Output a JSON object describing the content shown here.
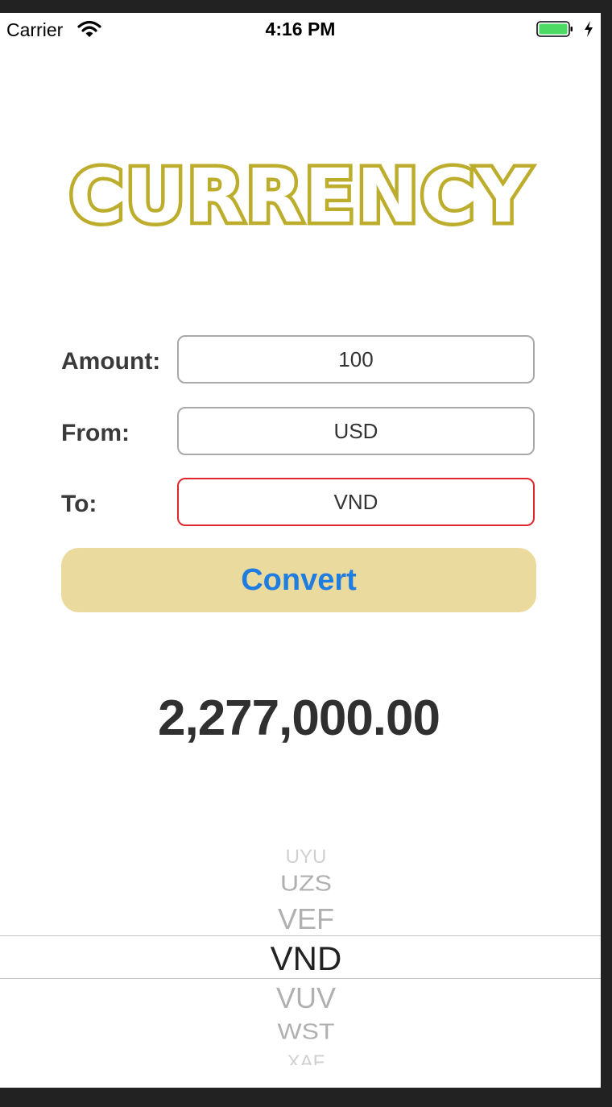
{
  "status_bar": {
    "carrier": "Carrier",
    "time": "4:16 PM",
    "battery_color": "#4cd964"
  },
  "app": {
    "title": "CURRENCY",
    "title_color": "#bcad2c"
  },
  "form": {
    "amount_label": "Amount:",
    "amount_value": "100",
    "from_label": "From:",
    "from_value": "USD",
    "to_label": "To:",
    "to_value": "VND",
    "active_field_border": "#e0262d"
  },
  "convert_button": {
    "label": "Convert",
    "background": "#ebda9e",
    "text_color": "#1f7ce0"
  },
  "result": "2,277,000.00",
  "picker": {
    "items": [
      "UYU",
      "UZS",
      "VEF",
      "VND",
      "VUV",
      "WST",
      "XAF"
    ],
    "selected": "VND"
  }
}
